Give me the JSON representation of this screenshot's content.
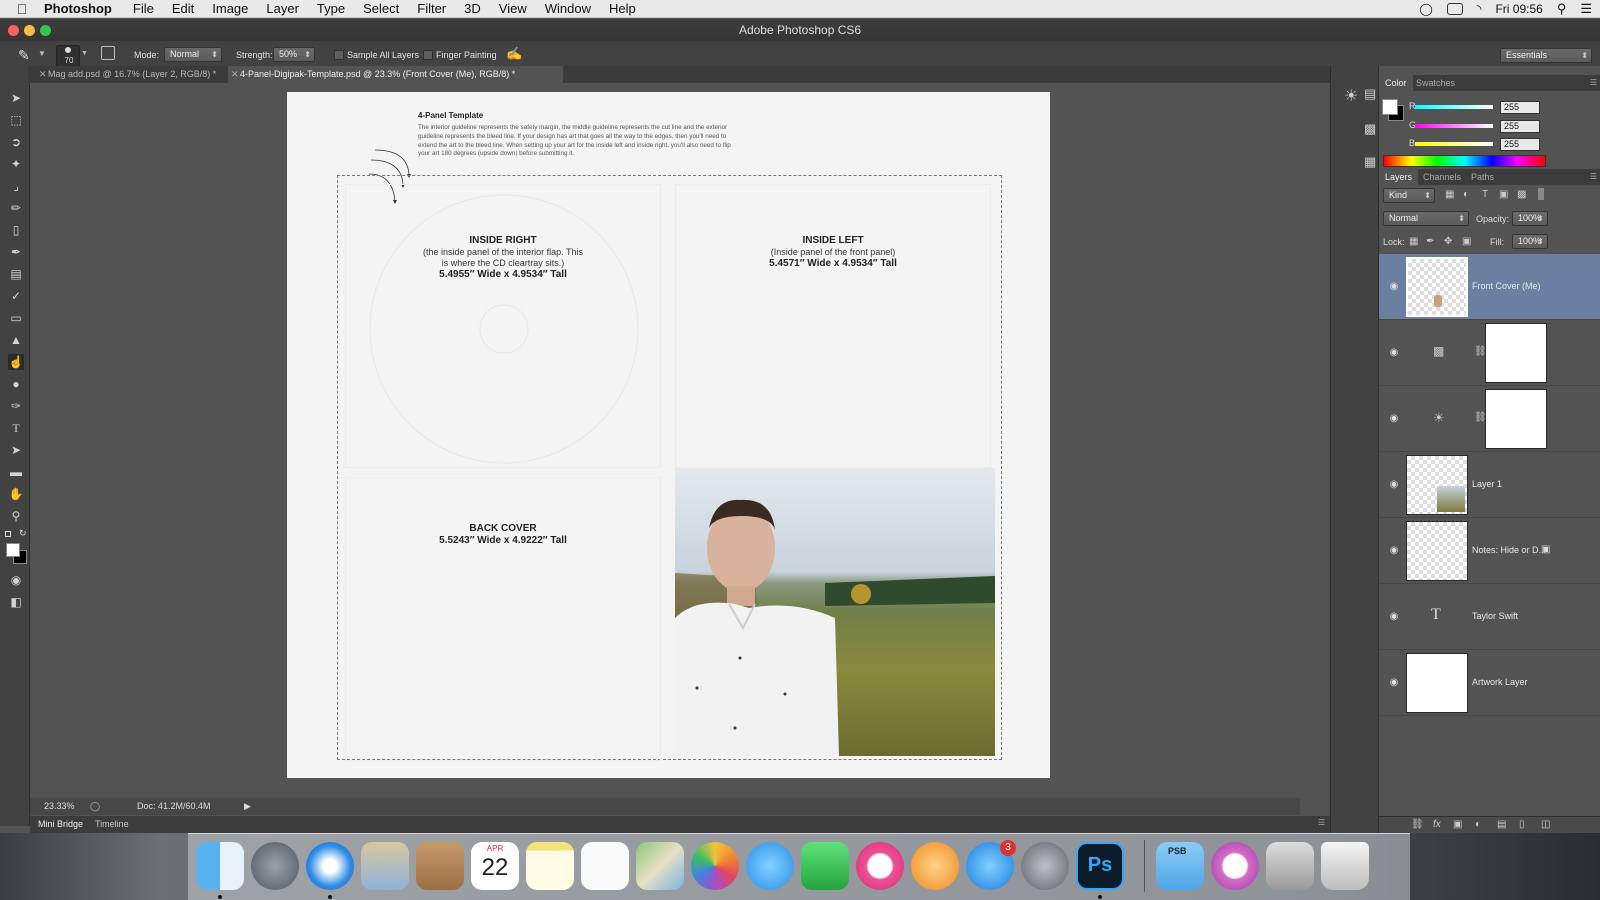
{
  "menubar": {
    "app": "Photoshop",
    "items": [
      "File",
      "Edit",
      "Image",
      "Layer",
      "Type",
      "Select",
      "Filter",
      "3D",
      "View",
      "Window",
      "Help"
    ],
    "clock": "Fri 09:56"
  },
  "window": {
    "title": "Adobe Photoshop CS6"
  },
  "options": {
    "brush_size": "70",
    "mode_label": "Mode:",
    "mode_value": "Normal",
    "strength_label": "Strength:",
    "strength_value": "50%",
    "sample_all_layers": "Sample All Layers",
    "finger_painting": "Finger Painting",
    "workspace": "Essentials"
  },
  "tabs": [
    {
      "label": "Mag add.psd @ 16.7% (Layer 2, RGB/8) *",
      "active": false
    },
    {
      "label": "4-Panel-Digipak-Template.psd @ 23.3% (Front Cover (Me), RGB/8) *",
      "active": true
    }
  ],
  "document": {
    "heading": "4-Panel Template",
    "note_lines": [
      "The interior guideline represents the safety margin, the middle guideline represents the cut line and the exterior",
      "guideline represents the bleed line.  If your design has art that goes all the way to the edges, then you'll need to",
      "extend the art to the bleed line.  When setting up your art for the inside left and inside right, you'll also need to flip",
      "your art 180 degrees (upside down) before submitting it."
    ],
    "panels": {
      "inside_right": {
        "title": "INSIDE RIGHT",
        "sub1": "(the inside panel of the interior flap. This",
        "sub2": "is where the CD cleartray sits.)",
        "size": "5.4955″ Wide x 4.9534″ Tall"
      },
      "inside_left": {
        "title": "INSIDE LEFT",
        "sub1": "(Inside panel of the front panel)",
        "size": "5.4571″ Wide x 4.9534″ Tall"
      },
      "back_cover": {
        "title": "BACK COVER",
        "size": "5.5243″ Wide x 4.9222″ Tall"
      }
    }
  },
  "status": {
    "zoom": "23.33%",
    "doc": "Doc: 41.2M/60.4M"
  },
  "bottom_tabs": [
    "Mini Bridge",
    "Timeline"
  ],
  "color_panel": {
    "tabs": [
      "Color",
      "Swatches"
    ],
    "channels": [
      {
        "label": "R",
        "value": "255",
        "color": "#e0392f"
      },
      {
        "label": "G",
        "value": "255",
        "color": "#c23ec8"
      },
      {
        "label": "B",
        "value": "255",
        "color": "#e8e03a"
      }
    ]
  },
  "layers_panel": {
    "tabs": [
      "Layers",
      "Channels",
      "Paths"
    ],
    "kind": "Kind",
    "blend": "Normal",
    "opacity_label": "Opacity:",
    "opacity": "100%",
    "lock_label": "Lock:",
    "fill_label": "Fill:",
    "fill": "100%",
    "layers": [
      {
        "name": "Front Cover (Me)",
        "selected": true
      },
      {
        "name": "",
        "type": "levels-adjustment"
      },
      {
        "name": "",
        "type": "brightness-adjustment"
      },
      {
        "name": "Layer 1"
      },
      {
        "name": "Notes: Hide or D..."
      },
      {
        "name": "Taylor Swift",
        "type": "text"
      },
      {
        "name": "Artwork Layer"
      }
    ]
  },
  "dock": {
    "calendar_month": "APR",
    "calendar_day": "22",
    "appstore_badge": "3",
    "ps_label": "Ps",
    "psb_label": "PSB"
  }
}
